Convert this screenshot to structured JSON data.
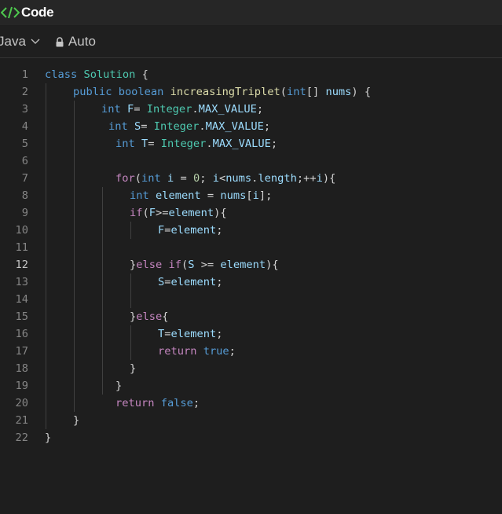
{
  "header": {
    "title": "Code",
    "icon": "code-brackets-icon",
    "accent": "#4ec94e"
  },
  "toolbar": {
    "language": "Java",
    "mode": "Auto"
  },
  "colors": {
    "keyword": "#569cd6",
    "control": "#c586c0",
    "type": "#4ec9b0",
    "function": "#dcdcaa",
    "variable": "#9cdcfe",
    "number": "#b5cea8"
  },
  "editor": {
    "active_line": 12,
    "lines": [
      {
        "n": "1",
        "i": 0,
        "t": [
          [
            "kw",
            "class"
          ],
          [
            "op",
            " "
          ],
          [
            "cls",
            "Solution"
          ],
          [
            "op",
            " {"
          ]
        ]
      },
      {
        "n": "2",
        "i": 36,
        "t": [
          [
            "kw",
            "public"
          ],
          [
            "op",
            " "
          ],
          [
            "kw",
            "boolean"
          ],
          [
            "op",
            " "
          ],
          [
            "fn",
            "increasingTriplet"
          ],
          [
            "op",
            "("
          ],
          [
            "kw",
            "int"
          ],
          [
            "op",
            "[] "
          ],
          [
            "var",
            "nums"
          ],
          [
            "op",
            ") {"
          ]
        ]
      },
      {
        "n": "3",
        "i": 72,
        "t": [
          [
            "kw",
            "int"
          ],
          [
            "op",
            " "
          ],
          [
            "var",
            "F"
          ],
          [
            "op",
            "= "
          ],
          [
            "cls",
            "Integer"
          ],
          [
            "op",
            "."
          ],
          [
            "var",
            "MAX_VALUE"
          ],
          [
            "op",
            ";"
          ]
        ]
      },
      {
        "n": "4",
        "i": 81,
        "t": [
          [
            "kw",
            "int"
          ],
          [
            "op",
            " "
          ],
          [
            "var",
            "S"
          ],
          [
            "op",
            "= "
          ],
          [
            "cls",
            "Integer"
          ],
          [
            "op",
            "."
          ],
          [
            "var",
            "MAX_VALUE"
          ],
          [
            "op",
            ";"
          ]
        ]
      },
      {
        "n": "5",
        "i": 90,
        "t": [
          [
            "kw",
            "int"
          ],
          [
            "op",
            " "
          ],
          [
            "var",
            "T"
          ],
          [
            "op",
            "= "
          ],
          [
            "cls",
            "Integer"
          ],
          [
            "op",
            "."
          ],
          [
            "var",
            "MAX_VALUE"
          ],
          [
            "op",
            ";"
          ]
        ]
      },
      {
        "n": "6",
        "i": 0,
        "t": []
      },
      {
        "n": "7",
        "i": 90,
        "t": [
          [
            "ctl",
            "for"
          ],
          [
            "op",
            "("
          ],
          [
            "kw",
            "int"
          ],
          [
            "op",
            " "
          ],
          [
            "var",
            "i"
          ],
          [
            "op",
            " = "
          ],
          [
            "num",
            "0"
          ],
          [
            "op",
            "; "
          ],
          [
            "var",
            "i"
          ],
          [
            "op",
            "<"
          ],
          [
            "var",
            "nums"
          ],
          [
            "op",
            "."
          ],
          [
            "var",
            "length"
          ],
          [
            "op",
            ";++"
          ],
          [
            "var",
            "i"
          ],
          [
            "op",
            "){"
          ]
        ]
      },
      {
        "n": "8",
        "i": 108,
        "t": [
          [
            "kw",
            "int"
          ],
          [
            "op",
            " "
          ],
          [
            "var",
            "element"
          ],
          [
            "op",
            " = "
          ],
          [
            "var",
            "nums"
          ],
          [
            "op",
            "["
          ],
          [
            "var",
            "i"
          ],
          [
            "op",
            "];"
          ]
        ]
      },
      {
        "n": "9",
        "i": 108,
        "t": [
          [
            "ctl",
            "if"
          ],
          [
            "op",
            "("
          ],
          [
            "var",
            "F"
          ],
          [
            "op",
            ">="
          ],
          [
            "var",
            "element"
          ],
          [
            "op",
            "){"
          ]
        ]
      },
      {
        "n": "10",
        "i": 144,
        "t": [
          [
            "var",
            "F"
          ],
          [
            "op",
            "="
          ],
          [
            "var",
            "element"
          ],
          [
            "op",
            ";"
          ]
        ]
      },
      {
        "n": "11",
        "i": 0,
        "t": []
      },
      {
        "n": "12",
        "i": 108,
        "t": [
          [
            "op",
            "}"
          ],
          [
            "ctl",
            "else"
          ],
          [
            "op",
            " "
          ],
          [
            "ctl",
            "if"
          ],
          [
            "op",
            "("
          ],
          [
            "var",
            "S"
          ],
          [
            "op",
            " >= "
          ],
          [
            "var",
            "element"
          ],
          [
            "op",
            "){"
          ]
        ]
      },
      {
        "n": "13",
        "i": 144,
        "t": [
          [
            "var",
            "S"
          ],
          [
            "op",
            "="
          ],
          [
            "var",
            "element"
          ],
          [
            "op",
            ";"
          ]
        ]
      },
      {
        "n": "14",
        "i": 0,
        "t": []
      },
      {
        "n": "15",
        "i": 108,
        "t": [
          [
            "op",
            "}"
          ],
          [
            "ctl",
            "else"
          ],
          [
            "op",
            "{"
          ]
        ]
      },
      {
        "n": "16",
        "i": 144,
        "t": [
          [
            "var",
            "T"
          ],
          [
            "op",
            "="
          ],
          [
            "var",
            "element"
          ],
          [
            "op",
            ";"
          ]
        ]
      },
      {
        "n": "17",
        "i": 144,
        "t": [
          [
            "ctl",
            "return"
          ],
          [
            "op",
            " "
          ],
          [
            "kw",
            "true"
          ],
          [
            "op",
            ";"
          ]
        ]
      },
      {
        "n": "18",
        "i": 108,
        "t": [
          [
            "op",
            "}"
          ]
        ]
      },
      {
        "n": "19",
        "i": 90,
        "t": [
          [
            "op",
            "}"
          ]
        ]
      },
      {
        "n": "20",
        "i": 90,
        "t": [
          [
            "ctl",
            "return"
          ],
          [
            "op",
            " "
          ],
          [
            "kw",
            "false"
          ],
          [
            "op",
            ";"
          ]
        ]
      },
      {
        "n": "21",
        "i": 36,
        "t": [
          [
            "op",
            "}"
          ]
        ]
      },
      {
        "n": "22",
        "i": 0,
        "t": [
          [
            "op",
            "}"
          ]
        ]
      }
    ]
  }
}
